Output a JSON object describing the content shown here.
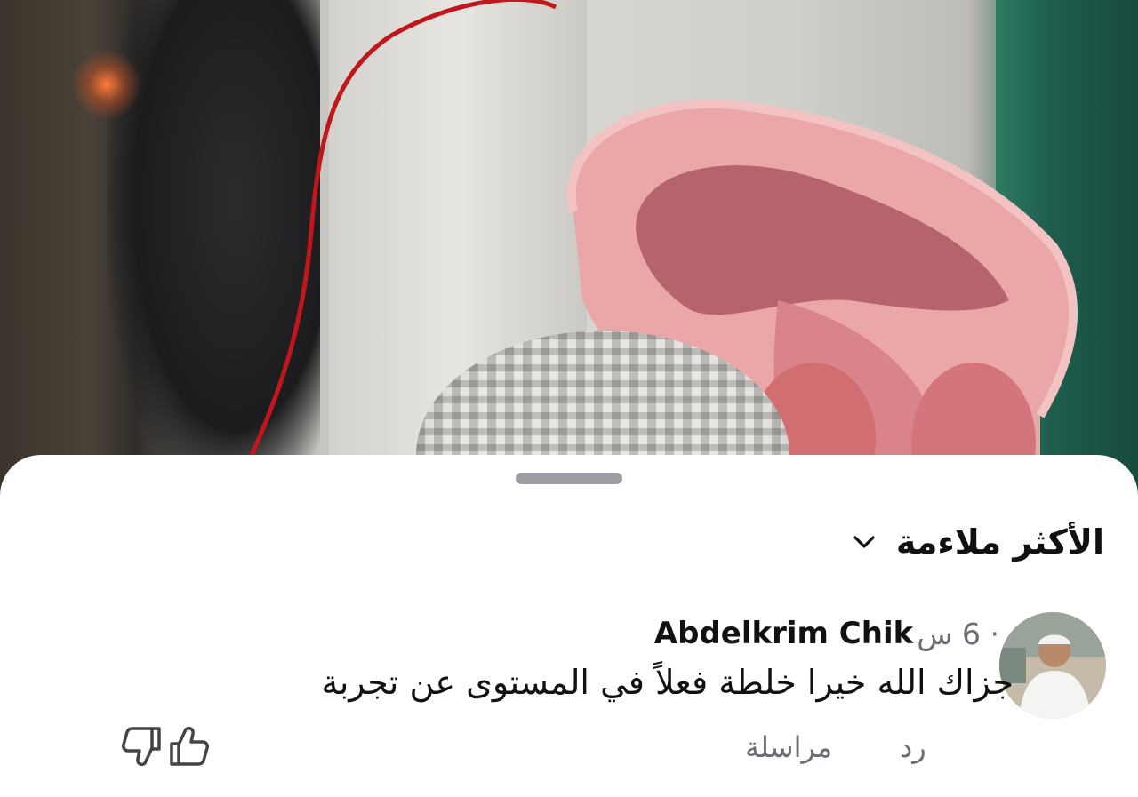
{
  "sheet": {
    "sort_label": "الأكثر ملاءمة"
  },
  "comment": {
    "author": "Abdelkrim Chik",
    "time": "· 6 س",
    "text": "جزاك الله خيرا خلطة فعلاً في المستوى عن تجربة",
    "actions": {
      "reply": "رد",
      "message": "مراسلة"
    }
  },
  "icons": {
    "sort": "chevron-down-icon",
    "like": "thumbs-up-icon",
    "dislike": "thumbs-down-icon"
  },
  "colors": {
    "sheet_bg": "#ffffff",
    "secondary_text": "#6b6e73",
    "handle": "#9c9ea3"
  }
}
